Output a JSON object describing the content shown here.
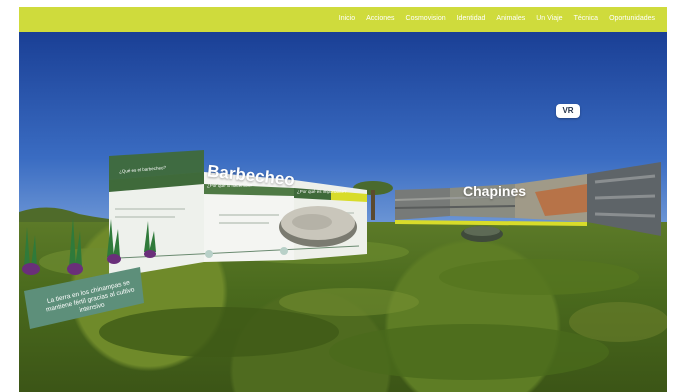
{
  "nav": {
    "items": [
      {
        "label": "Inicio"
      },
      {
        "label": "Acciones"
      },
      {
        "label": "Cosmovision"
      },
      {
        "label": "Identidad"
      },
      {
        "label": "Animales"
      },
      {
        "label": "Un Viaje"
      },
      {
        "label": "Técnica"
      },
      {
        "label": "Oportunidades"
      }
    ]
  },
  "scene": {
    "vr_label": "VR",
    "barbecheo_title": "Barbecheo",
    "chapines_title": "Chapines",
    "barbecheo_panel": {
      "tab1": "¿Qué es el barbecheo?",
      "tab2": "¿Por qué lo hacemos?",
      "tab3": "¿Por qué es importante?"
    },
    "info_sign": "La tierra en los chinampas se mantiene fértil gracias al cultivo intensivo"
  },
  "colors": {
    "nav_bg": "#cfdb3c",
    "panel_green": "#3f6a3a",
    "accent_yellow": "#d8dc2a"
  }
}
